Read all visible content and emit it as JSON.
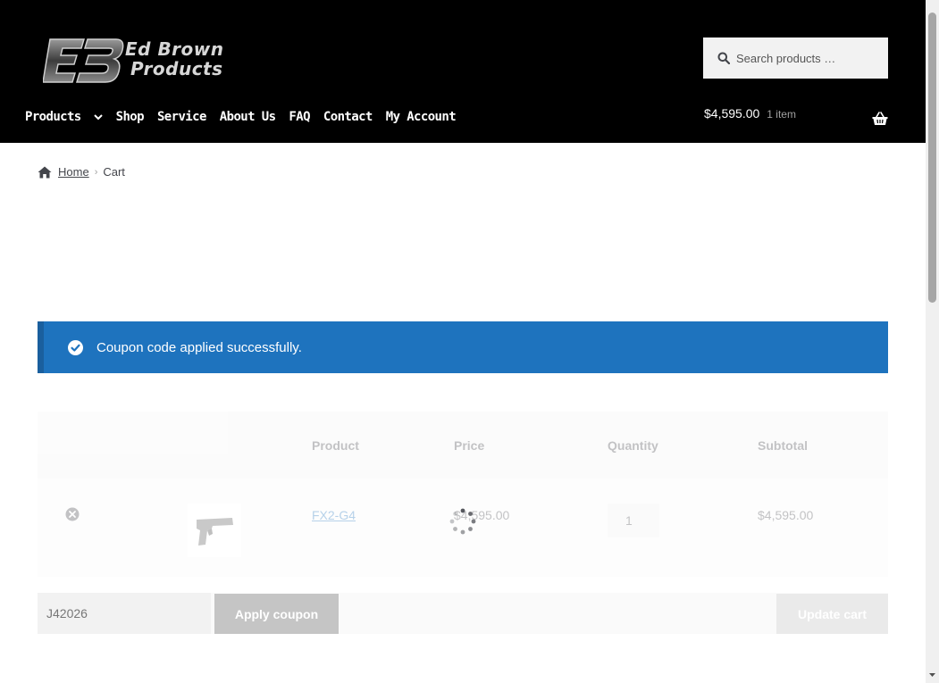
{
  "header": {
    "logo_line1": "Ed Brown",
    "logo_line2": "Products",
    "search_placeholder": "Search products …",
    "nav": [
      {
        "label": "Products"
      },
      {
        "label": "Shop"
      },
      {
        "label": "Service"
      },
      {
        "label": "About Us"
      },
      {
        "label": "FAQ"
      },
      {
        "label": "Contact"
      },
      {
        "label": "My Account"
      }
    ],
    "cart_amount": "$4,595.00",
    "cart_count": "1 item"
  },
  "breadcrumb": {
    "home": "Home",
    "separator": "›",
    "current": "Cart"
  },
  "notice": {
    "message": "Coupon code applied successfully."
  },
  "cart": {
    "headers": {
      "product": "Product",
      "price": "Price",
      "quantity": "Quantity",
      "subtotal": "Subtotal"
    },
    "items": [
      {
        "name": "FX2-G4",
        "price": "$4,595.00",
        "quantity": "1",
        "subtotal": "$4,595.00"
      }
    ],
    "coupon_value": "J42026",
    "apply_label": "Apply coupon",
    "update_label": "Update cart"
  },
  "colors": {
    "header_bg": "#000000",
    "notice_bg": "#1e73be",
    "link": "#1e73be",
    "text": "#43454b"
  },
  "icons": {
    "search": "search-icon",
    "chevron": "chevron-down-icon",
    "basket": "basket-icon",
    "home": "home-icon",
    "check": "check-circle-icon",
    "remove": "remove-circle-icon",
    "spinner": "loading-spinner-icon"
  }
}
